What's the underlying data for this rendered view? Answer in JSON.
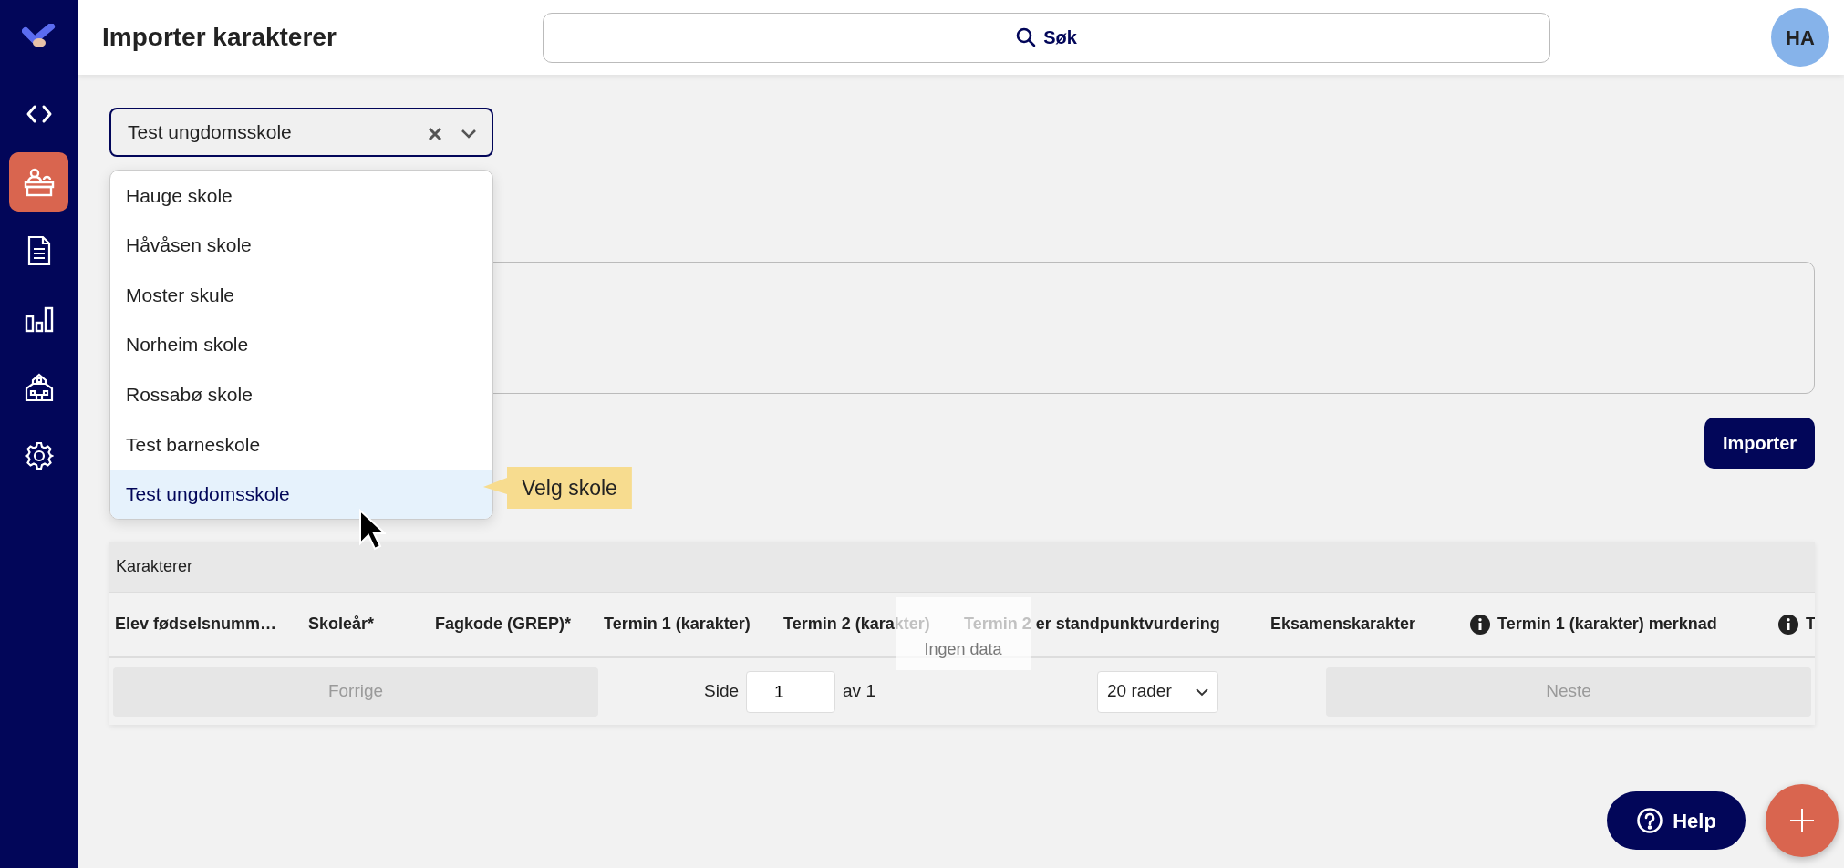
{
  "sidebar": {
    "items": [
      {
        "kind": "code",
        "selected": false
      },
      {
        "kind": "desk",
        "selected": true
      },
      {
        "kind": "document",
        "selected": false
      },
      {
        "kind": "chart",
        "selected": false
      },
      {
        "kind": "school",
        "selected": false
      },
      {
        "kind": "settings",
        "selected": false
      }
    ]
  },
  "header": {
    "title": "Importer karakterer",
    "search": {
      "label": "Søk"
    },
    "avatar": "HA"
  },
  "school_select": {
    "value": "Test ungdomsskole",
    "options": [
      {
        "label": "Hauge skole",
        "selected": false
      },
      {
        "label": "Håvåsen skole",
        "selected": false
      },
      {
        "label": "Moster skule",
        "selected": false
      },
      {
        "label": "Norheim skole",
        "selected": false
      },
      {
        "label": "Rossabø skole",
        "selected": false
      },
      {
        "label": "Test barneskole",
        "selected": false
      },
      {
        "label": "Test ungdomsskole",
        "selected": true
      }
    ],
    "tooltip": "Velg skole"
  },
  "import_button": "Importer",
  "table": {
    "title": "Karakterer",
    "columns": [
      {
        "label": "Elev fødselsnumm…",
        "info": false
      },
      {
        "label": "Skoleår*",
        "info": false
      },
      {
        "label": "Fagkode (GREP)*",
        "info": false
      },
      {
        "label": "Termin 1 (karakter)",
        "info": false
      },
      {
        "label": "Termin 2 (karakter)",
        "info": false
      },
      {
        "label": "Termin 2 er standpunktvurdering",
        "info": false
      },
      {
        "label": "Eksamenskarakter",
        "info": false
      },
      {
        "label": "Termin 1 (karakter) merknad",
        "info": true
      },
      {
        "label": "T",
        "info": true
      }
    ],
    "empty_text": "Ingen data",
    "pagination": {
      "previous": "Forrige",
      "page_label": "Side",
      "page": "1",
      "page_count": "av 1",
      "page_size": "20 rader",
      "next": "Neste"
    }
  },
  "help_button": "Help"
}
